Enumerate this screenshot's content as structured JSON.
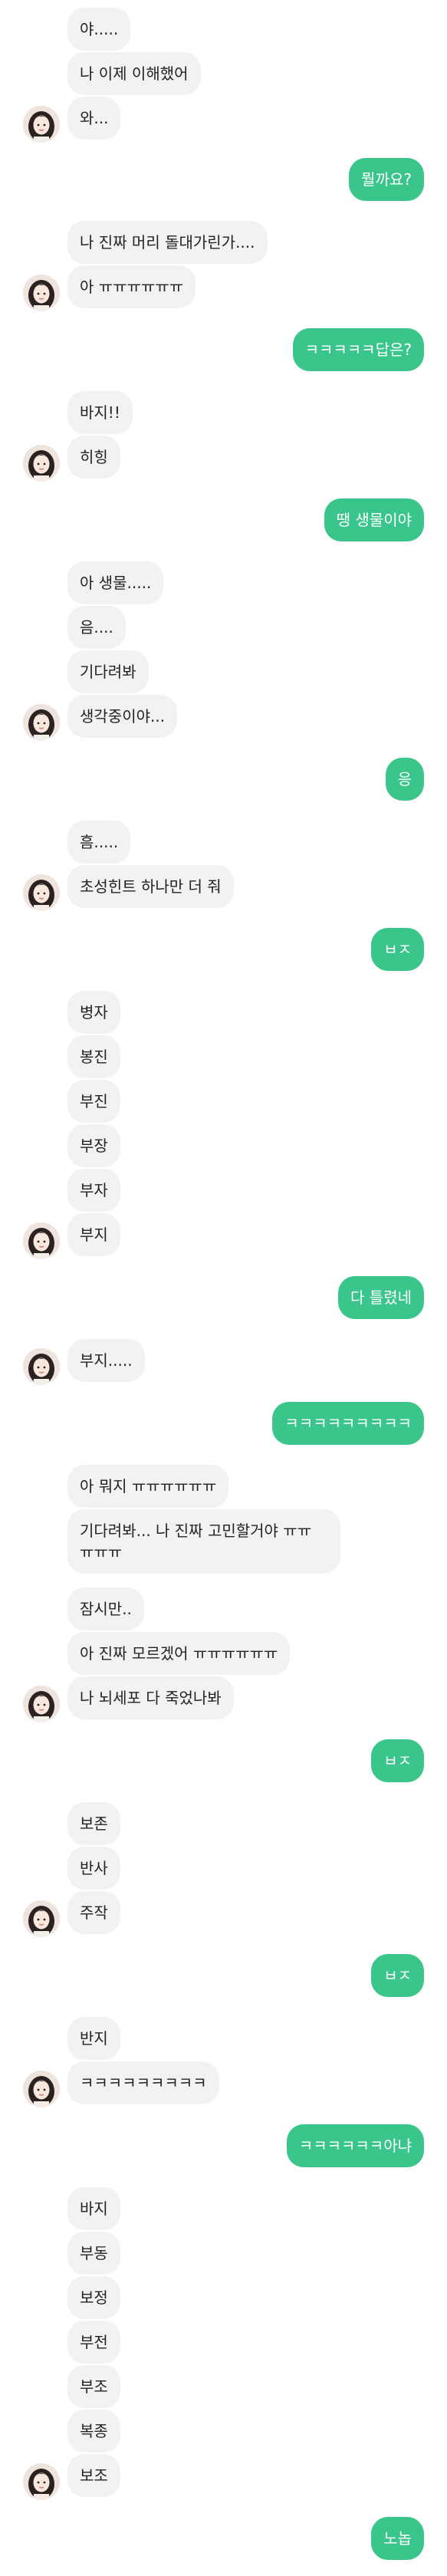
{
  "chat": {
    "messages": [
      {
        "side": "in",
        "text": "야....."
      },
      {
        "side": "in",
        "text": "나 이제 이해했어"
      },
      {
        "side": "in",
        "text": "와...",
        "avatar": true
      },
      {
        "side": "out",
        "text": "뭘까요?"
      },
      {
        "side": "in",
        "text": "나 진짜 머리 돌대가린가...."
      },
      {
        "side": "in",
        "text": "아 ㅠㅠㅠㅠㅠㅠ",
        "avatar": true
      },
      {
        "side": "out",
        "text": "ㅋㅋㅋㅋㅋ답은?"
      },
      {
        "side": "in",
        "text": "바지!!"
      },
      {
        "side": "in",
        "text": "히힝",
        "avatar": true
      },
      {
        "side": "out",
        "text": "땡 생물이야"
      },
      {
        "side": "in",
        "text": "아 생물....."
      },
      {
        "side": "in",
        "text": "음...."
      },
      {
        "side": "in",
        "text": "기다려봐"
      },
      {
        "side": "in",
        "text": "생각중이야...",
        "avatar": true
      },
      {
        "side": "out",
        "text": "응"
      },
      {
        "side": "in",
        "text": "흠....."
      },
      {
        "side": "in",
        "text": "초성힌트 하나만 더 줘",
        "avatar": true
      },
      {
        "side": "out",
        "text": "ㅂㅈ"
      },
      {
        "side": "in",
        "text": "병자"
      },
      {
        "side": "in",
        "text": "봉진"
      },
      {
        "side": "in",
        "text": "부진"
      },
      {
        "side": "in",
        "text": "부장"
      },
      {
        "side": "in",
        "text": "부자"
      },
      {
        "side": "in",
        "text": "부지",
        "avatar": true
      },
      {
        "side": "out",
        "text": "다 틀렸네"
      },
      {
        "side": "in",
        "text": "부지.....",
        "avatar": true
      },
      {
        "side": "out",
        "text": "ㅋㅋㅋㅋㅋㅋㅋㅋㅋ"
      },
      {
        "side": "in",
        "text": "아 뭐지 ㅠㅠㅠㅠㅠㅠ"
      },
      {
        "side": "in",
        "text": "기다려봐... 나 진짜 고민할거야 ㅠㅠ ㅠㅠㅠ"
      },
      {
        "side": "in",
        "text": "잠시만.."
      },
      {
        "side": "in",
        "text": "아 진짜 모르겠어 ㅠㅠㅠㅠㅠㅠ"
      },
      {
        "side": "in",
        "text": "나 뇌세포 다 죽었나봐",
        "avatar": true
      },
      {
        "side": "out",
        "text": "ㅂㅈ"
      },
      {
        "side": "in",
        "text": "보존"
      },
      {
        "side": "in",
        "text": "반사"
      },
      {
        "side": "in",
        "text": "주작",
        "avatar": true
      },
      {
        "side": "out",
        "text": "ㅂㅈ"
      },
      {
        "side": "in",
        "text": "반지"
      },
      {
        "side": "in",
        "text": "ㅋㅋㅋㅋㅋㅋㅋㅋㅋ",
        "avatar": true
      },
      {
        "side": "out",
        "text": "ㅋㅋㅋㅋㅋㅋ아냐"
      },
      {
        "side": "in",
        "text": "바지"
      },
      {
        "side": "in",
        "text": "부동"
      },
      {
        "side": "in",
        "text": "보정"
      },
      {
        "side": "in",
        "text": "부전"
      },
      {
        "side": "in",
        "text": "부조"
      },
      {
        "side": "in",
        "text": "복종"
      },
      {
        "side": "in",
        "text": "보조",
        "avatar": true
      },
      {
        "side": "out",
        "text": "노놉"
      }
    ]
  }
}
